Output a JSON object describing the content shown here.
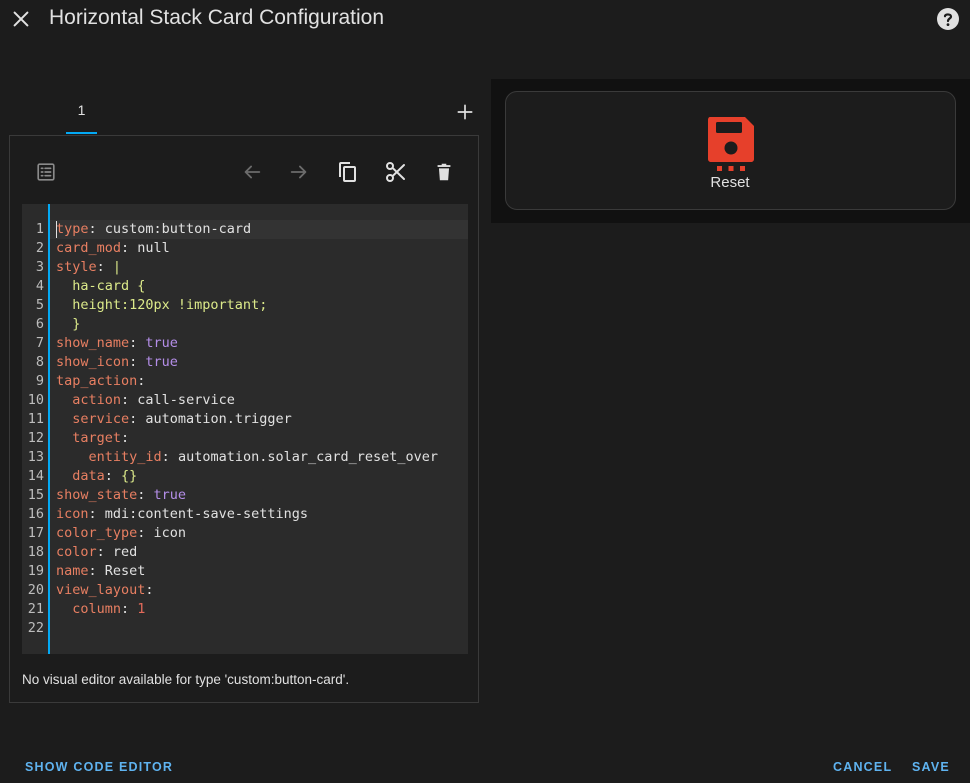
{
  "dialog": {
    "title": "Horizontal Stack Card Configuration"
  },
  "tabs": [
    {
      "label": "1"
    }
  ],
  "editor": {
    "lines": [
      [
        {
          "t": "type",
          "c": "k"
        },
        {
          "t": ": ",
          "c": "p"
        },
        {
          "t": "custom:button-card",
          "c": "v"
        }
      ],
      [
        {
          "t": "card_mod",
          "c": "k"
        },
        {
          "t": ": ",
          "c": "p"
        },
        {
          "t": "null",
          "c": "v"
        }
      ],
      [
        {
          "t": "style",
          "c": "k"
        },
        {
          "t": ": ",
          "c": "p"
        },
        {
          "t": "|",
          "c": "s"
        }
      ],
      [
        {
          "t": "  ha-card {",
          "c": "s"
        }
      ],
      [
        {
          "t": "  height:120px !important;",
          "c": "s"
        }
      ],
      [
        {
          "t": "  }",
          "c": "s"
        }
      ],
      [
        {
          "t": "show_name",
          "c": "k"
        },
        {
          "t": ": ",
          "c": "p"
        },
        {
          "t": "true",
          "c": "b"
        }
      ],
      [
        {
          "t": "show_icon",
          "c": "k"
        },
        {
          "t": ": ",
          "c": "p"
        },
        {
          "t": "true",
          "c": "b"
        }
      ],
      [
        {
          "t": "tap_action",
          "c": "k"
        },
        {
          "t": ":",
          "c": "p"
        }
      ],
      [
        {
          "t": "  action",
          "c": "k"
        },
        {
          "t": ": ",
          "c": "p"
        },
        {
          "t": "call-service",
          "c": "v"
        }
      ],
      [
        {
          "t": "  service",
          "c": "k"
        },
        {
          "t": ": ",
          "c": "p"
        },
        {
          "t": "automation.trigger",
          "c": "v"
        }
      ],
      [
        {
          "t": "  target",
          "c": "k"
        },
        {
          "t": ":",
          "c": "p"
        }
      ],
      [
        {
          "t": "    entity_id",
          "c": "k"
        },
        {
          "t": ": ",
          "c": "p"
        },
        {
          "t": "automation.solar_card_reset_over",
          "c": "v"
        }
      ],
      [
        {
          "t": "  data",
          "c": "k"
        },
        {
          "t": ": ",
          "c": "p"
        },
        {
          "t": "{}",
          "c": "s"
        }
      ],
      [
        {
          "t": "show_state",
          "c": "k"
        },
        {
          "t": ": ",
          "c": "p"
        },
        {
          "t": "true",
          "c": "b"
        }
      ],
      [
        {
          "t": "icon",
          "c": "k"
        },
        {
          "t": ": ",
          "c": "p"
        },
        {
          "t": "mdi:content-save-settings",
          "c": "v"
        }
      ],
      [
        {
          "t": "color_type",
          "c": "k"
        },
        {
          "t": ": ",
          "c": "p"
        },
        {
          "t": "icon",
          "c": "v"
        }
      ],
      [
        {
          "t": "color",
          "c": "k"
        },
        {
          "t": ": ",
          "c": "p"
        },
        {
          "t": "red",
          "c": "v"
        }
      ],
      [
        {
          "t": "name",
          "c": "k"
        },
        {
          "t": ": ",
          "c": "p"
        },
        {
          "t": "Reset",
          "c": "v"
        }
      ],
      [
        {
          "t": "view_layout",
          "c": "k"
        },
        {
          "t": ":",
          "c": "p"
        }
      ],
      [
        {
          "t": "  column",
          "c": "k"
        },
        {
          "t": ": ",
          "c": "p"
        },
        {
          "t": "1",
          "c": "n"
        }
      ],
      []
    ],
    "no_visual_editor_text": "No visual editor available for type 'custom:button-card'."
  },
  "preview": {
    "card_name": "Reset",
    "icon": "content-save-settings-icon",
    "icon_color": "#e6402b"
  },
  "footer": {
    "show_code_editor": "SHOW CODE EDITOR",
    "cancel": "CANCEL",
    "save": "SAVE"
  },
  "colors": {
    "accent": "#03a9f4",
    "link": "#5fb3f0",
    "background": "#1c1c1c"
  }
}
